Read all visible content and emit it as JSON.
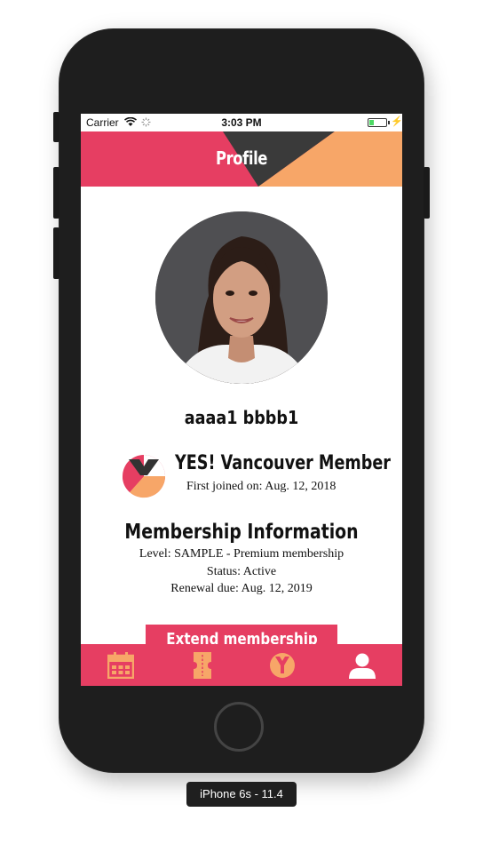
{
  "status_bar": {
    "carrier": "Carrier",
    "time": "3:03 PM"
  },
  "header": {
    "title": "Profile",
    "colors": {
      "pink": "#e63e62",
      "orange": "#f7a668",
      "dark": "#3a3a3a"
    }
  },
  "profile": {
    "username": "aaaa1 bbbb1",
    "avatar_icon": "profile-photo"
  },
  "membership_badge": {
    "title": "YES! Vancouver Member",
    "joined": "First joined on: Aug. 12, 2018",
    "logo_icon": "yes-vancouver-logo"
  },
  "membership_info": {
    "title": "Membership Information",
    "level": "Level: SAMPLE - Premium membership",
    "status": "Status: Active",
    "renewal": "Renewal due: Aug. 12, 2019"
  },
  "actions": {
    "extend_label": "Extend membership"
  },
  "tab_bar": {
    "items": [
      {
        "icon": "calendar-icon"
      },
      {
        "icon": "ticket-icon"
      },
      {
        "icon": "yes-logo-icon"
      },
      {
        "icon": "profile-icon"
      }
    ],
    "active_index": 3
  },
  "device_label": "iPhone 6s - 11.4"
}
